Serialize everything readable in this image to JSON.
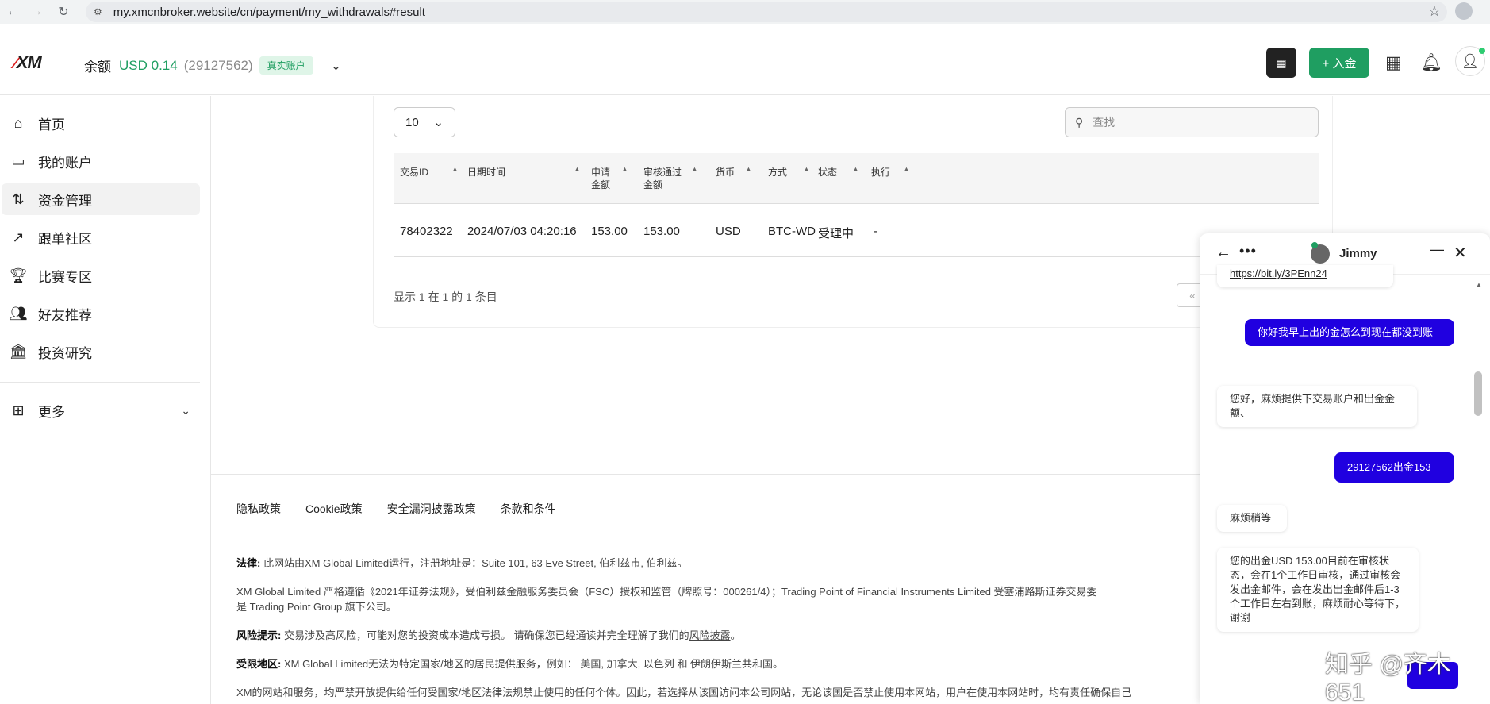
{
  "browser": {
    "url": "my.xmcnbroker.website/cn/payment/my_withdrawals#result"
  },
  "header": {
    "logo": "XM",
    "balance_label": "余额",
    "balance_amount": "USD 0.14",
    "account_number": "(29127562)",
    "account_badge": "真实账户",
    "deposit_label": "+ 入金"
  },
  "sidebar": {
    "items": [
      {
        "label": "首页",
        "icon": "home-icon"
      },
      {
        "label": "我的账户",
        "icon": "wallet-icon"
      },
      {
        "label": "资金管理",
        "icon": "transfer-icon"
      },
      {
        "label": "跟单社区",
        "icon": "trend-icon"
      },
      {
        "label": "比赛专区",
        "icon": "trophy-icon"
      },
      {
        "label": "好友推荐",
        "icon": "users-icon"
      },
      {
        "label": "投资研究",
        "icon": "bank-icon"
      }
    ],
    "more_label": "更多"
  },
  "table": {
    "page_size": "10",
    "search_placeholder": "查找",
    "columns": [
      "交易ID",
      "日期时间",
      "申请\n金额",
      "审核通过\n金额",
      "货币",
      "方式",
      "状态",
      "执行"
    ],
    "rows": [
      [
        "78402322",
        "2024/07/03 04:20:16",
        "153.00",
        "153.00",
        "USD",
        "BTC-WD",
        "受理中",
        "-"
      ]
    ],
    "info": "显示 1 在 1 的 1 条目"
  },
  "footer": {
    "links": [
      "隐私政策",
      "Cookie政策",
      "安全漏洞披露政策",
      "条款和条件"
    ],
    "legal_label": "法律:",
    "legal_text": " 此网站由XM Global Limited运行，注册地址是：Suite 101, 63 Eve Street, 伯利兹市, 伯利兹。",
    "reg_line1": "XM Global Limited 严格遵循《2021年证券法规》，受伯利兹金融服务委员会（FSC）授权和监管（牌照号：000261/4）；Trading Point of Financial Instruments Limited 受塞浦路斯证券交易委",
    "reg_line2": "是 Trading Point Group 旗下公司。",
    "risk_label": "风险提示:",
    "risk_text": " 交易涉及高风险，可能对您的投资成本造成亏损。 请确保您已经通读并完全理解了我们的",
    "risk_link": "风险披露",
    "risk_end": "。",
    "restrict_label": "受限地区:",
    "restrict_text": " XM Global Limited无法为特定国家/地区的居民提供服务，例如： 美国, 加拿大, 以色列 和 伊朗伊斯兰共和国。",
    "last_line": "XM的网站和服务，均严禁开放提供给任何受国家/地区法律法规禁止使用的任何个体。因此，若选择从该国访问本公司网站，无论该国是否禁止使用本网站，用户在使用本网站时，均有责任确保自己"
  },
  "chat": {
    "agent_name": "Jimmy",
    "messages": {
      "link": "https://bit.ly/3PEnn24",
      "out1": "你好我早上出的金怎么到现在都没到账",
      "in1": "您好，麻烦提供下交易账户和出金金额、",
      "out2": "29127562出金153",
      "in2": "麻烦稍等",
      "in3": "您的出金USD 153.00目前在审核状态，会在1个工作日审核，通过审核会发出金邮件，会在发出出金邮件后1-3个工作日左右到账，麻烦耐心等待下，谢谢"
    }
  },
  "watermark": "知乎 @齐木651",
  "colors": {
    "accent_green": "#1f9e61",
    "chat_blue": "#2000e0"
  }
}
